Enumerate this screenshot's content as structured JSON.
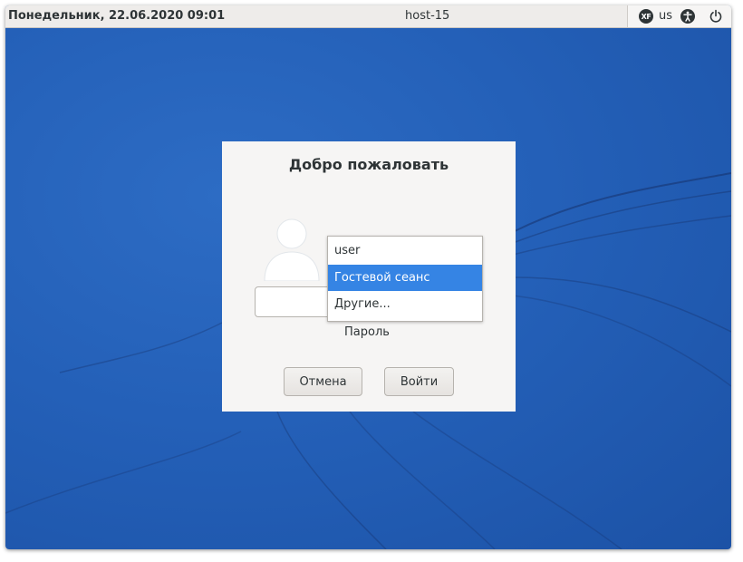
{
  "topbar": {
    "clock": "Понедельник, 22.06.2020 09:01",
    "hostname": "host-15",
    "keyboard_layout": "us",
    "tray_icons": [
      "xf-icon",
      "accessibility-icon",
      "power-icon"
    ]
  },
  "dialog": {
    "title": "Добро пожаловать",
    "user_menu": {
      "items": [
        "user",
        "Гостевой сеанс",
        "Другие..."
      ],
      "selected": "Гостевой сеанс"
    },
    "password_label": "Пароль",
    "cancel_label": "Отмена",
    "login_label": "Войти"
  },
  "colors": {
    "desktop": "#2460b8",
    "selection": "#3584e4",
    "panel": "#eeecea"
  }
}
